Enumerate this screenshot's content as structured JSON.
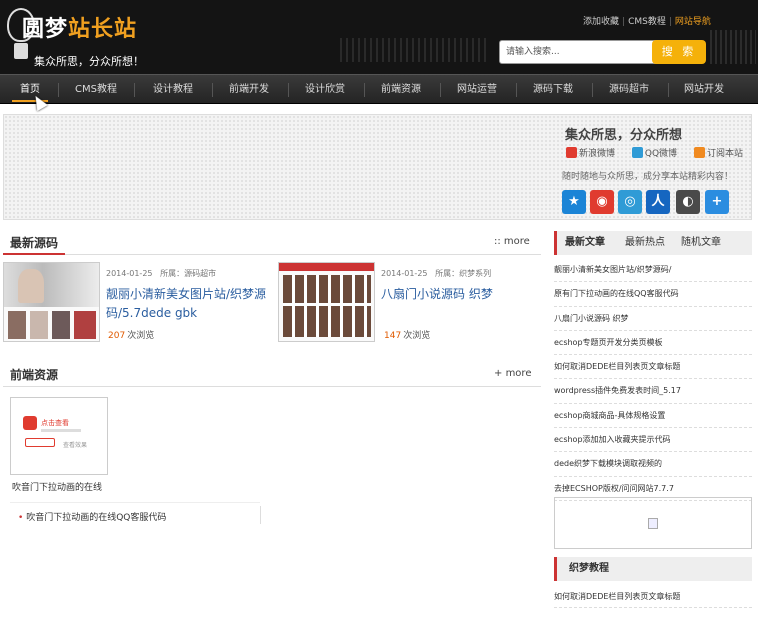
{
  "site": {
    "logo_text_a": "圆梦",
    "logo_text_b": "站长站",
    "slogan": "集众所思，分众所想！"
  },
  "top_links": [
    "添加收藏",
    "CMS教程",
    "网站导航"
  ],
  "search": {
    "placeholder": "请输入搜索...",
    "button": "搜 索"
  },
  "nav": [
    "首页",
    "CMS教程",
    "设计教程",
    "前端开发",
    "设计欣赏",
    "前端资源",
    "网站运营",
    "源码下载",
    "源码超市",
    "网站开发"
  ],
  "share": {
    "title": "集众所思，分众所想",
    "links": [
      "新浪微博",
      "QQ微博",
      "订阅本站"
    ],
    "desc": "随时随地与众所思，成分享本站精彩内容！",
    "icons": [
      {
        "name": "qzone-icon",
        "glyph": "★",
        "color": "#1b84d6"
      },
      {
        "name": "weibo-icon",
        "glyph": "◉",
        "color": "#e03b2f"
      },
      {
        "name": "tqq-icon",
        "glyph": "◎",
        "color": "#2f9bd6"
      },
      {
        "name": "renren-icon",
        "glyph": "人",
        "color": "#1566c0"
      },
      {
        "name": "wechat-icon",
        "glyph": "◐",
        "color": "#4a4a4a"
      },
      {
        "name": "more-share-icon",
        "glyph": "+",
        "color": "#2b8de0"
      }
    ]
  },
  "latest": {
    "title": "最新源码",
    "more": "more",
    "cards": [
      {
        "date": "2014-01-25",
        "category_label": "所属：",
        "category": "源码超市",
        "title": "靓丽小清新美女图片站/织梦源码/5.7dede gbk",
        "views": "207",
        "views_label": "次浏览"
      },
      {
        "date": "2014-01-25",
        "category_label": "所属：",
        "category": "织梦系列",
        "title": "八扇门小说源码 织梦",
        "views": "147",
        "views_label": "次浏览"
      }
    ]
  },
  "frontend": {
    "title": "前端资源",
    "more": "more",
    "thumb_caption_a": "点击查看",
    "thumb_caption_b": "查看效果",
    "item_title": "吹音门下拉动画的在线",
    "list": [
      "吹音门下拉动画的在线QQ客服代码"
    ]
  },
  "sidebar": {
    "tabs": [
      "最新文章",
      "最新热点",
      "随机文章"
    ],
    "articles": [
      "靓丽小清新美女图片站/织梦源码/",
      "原有门下拉动画的在线QQ客服代码",
      "八扇门小说源码 织梦",
      "ecshop专题页开发分类页模板",
      "如何取消DEDE栏目列表页文章标题",
      "wordpress插件免费发表时间_5.17",
      "ecshop商城商品-具体规格设置",
      "ecshop添加加入收藏夹提示代码",
      "dede织梦下载模块调取视频的",
      "去掉ECSHOP版权/问问网站7.7.7"
    ],
    "section2_title": "织梦教程",
    "section2_item": "如何取消DEDE栏目列表页文章标题"
  }
}
